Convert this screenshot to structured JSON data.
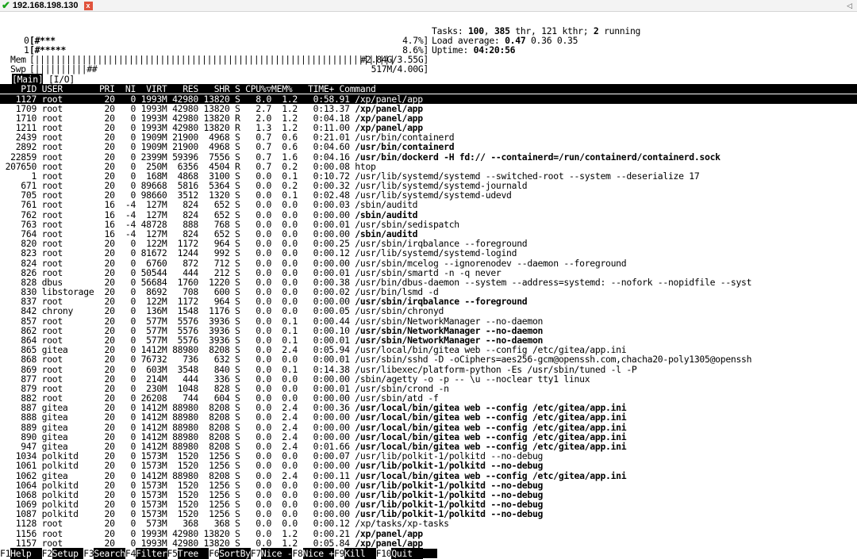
{
  "tab": {
    "title": "192.168.198.130",
    "status_icon": "check-icon",
    "close_icon": "close-icon",
    "scroll_icon": "scroll-left-icon"
  },
  "meters": {
    "cpu0": {
      "label": "0",
      "bar": "[#***",
      "value": "4.7%]"
    },
    "cpu1": {
      "label": "1",
      "bar": "[#*****",
      "value": "8.6%]"
    },
    "mem": {
      "label": "Mem",
      "bar": "[|||||||||||||||||||||||||||||||||||||||||||||||||||||||||||||||||||||",
      "value": "#2.84G/3.55G]"
    },
    "swp": {
      "label": "Swp",
      "bar": "[||||||||||##",
      "value": "517M/4.00G]"
    }
  },
  "summary": {
    "tasks": {
      "label": "Tasks:",
      "count": "100",
      "thr": "385",
      "thr_label": "thr,",
      "kthr": "121 kthr;",
      "running": "2",
      "running_label": "running"
    },
    "load": {
      "label": "Load average:",
      "v1": "0.47",
      "v2": "0.36 0.35"
    },
    "uptime": {
      "label": "Uptime:",
      "value": "04:20:56"
    }
  },
  "tabs_line": {
    "main": "Main",
    "io": "[I/O]"
  },
  "columns": [
    "PID",
    "USER",
    "PRI",
    "NI",
    "VIRT",
    "RES",
    "SHR",
    "S",
    "CPU%",
    "MEM%",
    "TIME+",
    "Command"
  ],
  "sort_indicator": "▽",
  "processes": [
    {
      "pid": "1127",
      "user": "root",
      "pri": "20",
      "ni": "0",
      "virt": "1993M",
      "res": "42980",
      "shr": "13820",
      "s": "S",
      "cpu": "8.0",
      "mem": "1.2",
      "time": "0:58.91",
      "cmd": "/xp/panel/app",
      "bold": false,
      "selected": true
    },
    {
      "pid": "1709",
      "user": "root",
      "pri": "20",
      "ni": "0",
      "virt": "1993M",
      "res": "42980",
      "shr": "13820",
      "s": "S",
      "cpu": "2.7",
      "mem": "1.2",
      "time": "0:13.37",
      "cmd": "/xp/panel/app",
      "bold": true
    },
    {
      "pid": "1710",
      "user": "root",
      "pri": "20",
      "ni": "0",
      "virt": "1993M",
      "res": "42980",
      "shr": "13820",
      "s": "R",
      "cpu": "2.0",
      "mem": "1.2",
      "time": "0:04.18",
      "cmd": "/xp/panel/app",
      "bold": true
    },
    {
      "pid": "1211",
      "user": "root",
      "pri": "20",
      "ni": "0",
      "virt": "1993M",
      "res": "42980",
      "shr": "13820",
      "s": "R",
      "cpu": "1.3",
      "mem": "1.2",
      "time": "0:11.00",
      "cmd": "/xp/panel/app",
      "bold": true
    },
    {
      "pid": "2439",
      "user": "root",
      "pri": "20",
      "ni": "0",
      "virt": "1909M",
      "res": "21900",
      "shr": "4968",
      "s": "S",
      "cpu": "0.7",
      "mem": "0.6",
      "time": "0:21.01",
      "cmd": "/usr/bin/containerd",
      "bold": false
    },
    {
      "pid": "2892",
      "user": "root",
      "pri": "20",
      "ni": "0",
      "virt": "1909M",
      "res": "21900",
      "shr": "4968",
      "s": "S",
      "cpu": "0.7",
      "mem": "0.6",
      "time": "0:04.60",
      "cmd": "/usr/bin/containerd",
      "bold": true
    },
    {
      "pid": "22859",
      "user": "root",
      "pri": "20",
      "ni": "0",
      "virt": "2399M",
      "res": "59396",
      "shr": "7556",
      "s": "S",
      "cpu": "0.7",
      "mem": "1.6",
      "time": "0:04.16",
      "cmd": "/usr/bin/dockerd -H fd:// --containerd=/run/containerd/containerd.sock",
      "bold": true
    },
    {
      "pid": "207650",
      "user": "root",
      "pri": "20",
      "ni": "0",
      "virt": "250M",
      "res": "6356",
      "shr": "4504",
      "s": "R",
      "cpu": "0.7",
      "mem": "0.2",
      "time": "0:00.08",
      "cmd": "htop",
      "bold": false
    },
    {
      "pid": "1",
      "user": "root",
      "pri": "20",
      "ni": "0",
      "virt": "168M",
      "res": "4868",
      "shr": "3100",
      "s": "S",
      "cpu": "0.0",
      "mem": "0.1",
      "time": "0:10.72",
      "cmd": "/usr/lib/systemd/systemd --switched-root --system --deserialize 17",
      "bold": false
    },
    {
      "pid": "671",
      "user": "root",
      "pri": "20",
      "ni": "0",
      "virt": "89668",
      "res": "5816",
      "shr": "5364",
      "s": "S",
      "cpu": "0.0",
      "mem": "0.2",
      "time": "0:00.32",
      "cmd": "/usr/lib/systemd/systemd-journald",
      "bold": false
    },
    {
      "pid": "705",
      "user": "root",
      "pri": "20",
      "ni": "0",
      "virt": "98660",
      "res": "3512",
      "shr": "1320",
      "s": "S",
      "cpu": "0.0",
      "mem": "0.1",
      "time": "0:02.48",
      "cmd": "/usr/lib/systemd/systemd-udevd",
      "bold": false
    },
    {
      "pid": "761",
      "user": "root",
      "pri": "16",
      "ni": "-4",
      "virt": "127M",
      "res": "824",
      "shr": "652",
      "s": "S",
      "cpu": "0.0",
      "mem": "0.0",
      "time": "0:00.03",
      "cmd": "/sbin/auditd",
      "bold": false
    },
    {
      "pid": "762",
      "user": "root",
      "pri": "16",
      "ni": "-4",
      "virt": "127M",
      "res": "824",
      "shr": "652",
      "s": "S",
      "cpu": "0.0",
      "mem": "0.0",
      "time": "0:00.00",
      "cmd": "/sbin/auditd",
      "bold": true
    },
    {
      "pid": "763",
      "user": "root",
      "pri": "16",
      "ni": "-4",
      "virt": "48728",
      "res": "888",
      "shr": "768",
      "s": "S",
      "cpu": "0.0",
      "mem": "0.0",
      "time": "0:00.01",
      "cmd": "/usr/sbin/sedispatch",
      "bold": false
    },
    {
      "pid": "764",
      "user": "root",
      "pri": "16",
      "ni": "-4",
      "virt": "127M",
      "res": "824",
      "shr": "652",
      "s": "S",
      "cpu": "0.0",
      "mem": "0.0",
      "time": "0:00.00",
      "cmd": "/sbin/auditd",
      "bold": true
    },
    {
      "pid": "820",
      "user": "root",
      "pri": "20",
      "ni": "0",
      "virt": "122M",
      "res": "1172",
      "shr": "964",
      "s": "S",
      "cpu": "0.0",
      "mem": "0.0",
      "time": "0:00.25",
      "cmd": "/usr/sbin/irqbalance --foreground",
      "bold": false
    },
    {
      "pid": "823",
      "user": "root",
      "pri": "20",
      "ni": "0",
      "virt": "81672",
      "res": "1244",
      "shr": "992",
      "s": "S",
      "cpu": "0.0",
      "mem": "0.0",
      "time": "0:00.12",
      "cmd": "/usr/lib/systemd/systemd-logind",
      "bold": false
    },
    {
      "pid": "824",
      "user": "root",
      "pri": "20",
      "ni": "0",
      "virt": "6760",
      "res": "872",
      "shr": "712",
      "s": "S",
      "cpu": "0.0",
      "mem": "0.0",
      "time": "0:00.00",
      "cmd": "/usr/sbin/mcelog --ignorenodev --daemon --foreground",
      "bold": false
    },
    {
      "pid": "826",
      "user": "root",
      "pri": "20",
      "ni": "0",
      "virt": "50544",
      "res": "444",
      "shr": "212",
      "s": "S",
      "cpu": "0.0",
      "mem": "0.0",
      "time": "0:00.01",
      "cmd": "/usr/sbin/smartd -n -q never",
      "bold": false
    },
    {
      "pid": "828",
      "user": "dbus",
      "pri": "20",
      "ni": "0",
      "virt": "56684",
      "res": "1760",
      "shr": "1220",
      "s": "S",
      "cpu": "0.0",
      "mem": "0.0",
      "time": "0:00.38",
      "cmd": "/usr/bin/dbus-daemon --system --address=systemd: --nofork --nopidfile --syst",
      "bold": false
    },
    {
      "pid": "830",
      "user": "libstorage",
      "pri": "20",
      "ni": "0",
      "virt": "8692",
      "res": "708",
      "shr": "600",
      "s": "S",
      "cpu": "0.0",
      "mem": "0.0",
      "time": "0:00.02",
      "cmd": "/usr/bin/lsmd -d",
      "bold": false
    },
    {
      "pid": "837",
      "user": "root",
      "pri": "20",
      "ni": "0",
      "virt": "122M",
      "res": "1172",
      "shr": "964",
      "s": "S",
      "cpu": "0.0",
      "mem": "0.0",
      "time": "0:00.00",
      "cmd": "/usr/sbin/irqbalance --foreground",
      "bold": true
    },
    {
      "pid": "842",
      "user": "chrony",
      "pri": "20",
      "ni": "0",
      "virt": "136M",
      "res": "1548",
      "shr": "1176",
      "s": "S",
      "cpu": "0.0",
      "mem": "0.0",
      "time": "0:00.05",
      "cmd": "/usr/sbin/chronyd",
      "bold": false
    },
    {
      "pid": "857",
      "user": "root",
      "pri": "20",
      "ni": "0",
      "virt": "577M",
      "res": "5576",
      "shr": "3936",
      "s": "S",
      "cpu": "0.0",
      "mem": "0.1",
      "time": "0:00.44",
      "cmd": "/usr/sbin/NetworkManager --no-daemon",
      "bold": false
    },
    {
      "pid": "862",
      "user": "root",
      "pri": "20",
      "ni": "0",
      "virt": "577M",
      "res": "5576",
      "shr": "3936",
      "s": "S",
      "cpu": "0.0",
      "mem": "0.1",
      "time": "0:00.10",
      "cmd": "/usr/sbin/NetworkManager --no-daemon",
      "bold": true
    },
    {
      "pid": "864",
      "user": "root",
      "pri": "20",
      "ni": "0",
      "virt": "577M",
      "res": "5576",
      "shr": "3936",
      "s": "S",
      "cpu": "0.0",
      "mem": "0.1",
      "time": "0:00.01",
      "cmd": "/usr/sbin/NetworkManager --no-daemon",
      "bold": true
    },
    {
      "pid": "865",
      "user": "gitea",
      "pri": "20",
      "ni": "0",
      "virt": "1412M",
      "res": "88980",
      "shr": "8208",
      "s": "S",
      "cpu": "0.0",
      "mem": "2.4",
      "time": "0:05.94",
      "cmd": "/usr/local/bin/gitea web --config /etc/gitea/app.ini",
      "bold": false
    },
    {
      "pid": "868",
      "user": "root",
      "pri": "20",
      "ni": "0",
      "virt": "76732",
      "res": "736",
      "shr": "632",
      "s": "S",
      "cpu": "0.0",
      "mem": "0.0",
      "time": "0:00.01",
      "cmd": "/usr/sbin/sshd -D -oCiphers=aes256-gcm@openssh.com,chacha20-poly1305@openssh",
      "bold": false
    },
    {
      "pid": "869",
      "user": "root",
      "pri": "20",
      "ni": "0",
      "virt": "603M",
      "res": "3548",
      "shr": "840",
      "s": "S",
      "cpu": "0.0",
      "mem": "0.1",
      "time": "0:14.38",
      "cmd": "/usr/libexec/platform-python -Es /usr/sbin/tuned -l -P",
      "bold": false
    },
    {
      "pid": "877",
      "user": "root",
      "pri": "20",
      "ni": "0",
      "virt": "214M",
      "res": "444",
      "shr": "336",
      "s": "S",
      "cpu": "0.0",
      "mem": "0.0",
      "time": "0:00.00",
      "cmd": "/sbin/agetty -o -p -- \\u --noclear tty1 linux",
      "bold": false
    },
    {
      "pid": "879",
      "user": "root",
      "pri": "20",
      "ni": "0",
      "virt": "230M",
      "res": "1048",
      "shr": "828",
      "s": "S",
      "cpu": "0.0",
      "mem": "0.0",
      "time": "0:00.01",
      "cmd": "/usr/sbin/crond -n",
      "bold": false
    },
    {
      "pid": "882",
      "user": "root",
      "pri": "20",
      "ni": "0",
      "virt": "26208",
      "res": "744",
      "shr": "604",
      "s": "S",
      "cpu": "0.0",
      "mem": "0.0",
      "time": "0:00.00",
      "cmd": "/usr/sbin/atd -f",
      "bold": false
    },
    {
      "pid": "887",
      "user": "gitea",
      "pri": "20",
      "ni": "0",
      "virt": "1412M",
      "res": "88980",
      "shr": "8208",
      "s": "S",
      "cpu": "0.0",
      "mem": "2.4",
      "time": "0:00.36",
      "cmd": "/usr/local/bin/gitea web --config /etc/gitea/app.ini",
      "bold": true
    },
    {
      "pid": "888",
      "user": "gitea",
      "pri": "20",
      "ni": "0",
      "virt": "1412M",
      "res": "88980",
      "shr": "8208",
      "s": "S",
      "cpu": "0.0",
      "mem": "2.4",
      "time": "0:00.00",
      "cmd": "/usr/local/bin/gitea web --config /etc/gitea/app.ini",
      "bold": true
    },
    {
      "pid": "889",
      "user": "gitea",
      "pri": "20",
      "ni": "0",
      "virt": "1412M",
      "res": "88980",
      "shr": "8208",
      "s": "S",
      "cpu": "0.0",
      "mem": "2.4",
      "time": "0:00.00",
      "cmd": "/usr/local/bin/gitea web --config /etc/gitea/app.ini",
      "bold": true
    },
    {
      "pid": "890",
      "user": "gitea",
      "pri": "20",
      "ni": "0",
      "virt": "1412M",
      "res": "88980",
      "shr": "8208",
      "s": "S",
      "cpu": "0.0",
      "mem": "2.4",
      "time": "0:00.00",
      "cmd": "/usr/local/bin/gitea web --config /etc/gitea/app.ini",
      "bold": true
    },
    {
      "pid": "947",
      "user": "gitea",
      "pri": "20",
      "ni": "0",
      "virt": "1412M",
      "res": "88980",
      "shr": "8208",
      "s": "S",
      "cpu": "0.0",
      "mem": "2.4",
      "time": "0:01.66",
      "cmd": "/usr/local/bin/gitea web --config /etc/gitea/app.ini",
      "bold": true
    },
    {
      "pid": "1034",
      "user": "polkitd",
      "pri": "20",
      "ni": "0",
      "virt": "1573M",
      "res": "1520",
      "shr": "1256",
      "s": "S",
      "cpu": "0.0",
      "mem": "0.0",
      "time": "0:00.07",
      "cmd": "/usr/lib/polkit-1/polkitd --no-debug",
      "bold": false
    },
    {
      "pid": "1061",
      "user": "polkitd",
      "pri": "20",
      "ni": "0",
      "virt": "1573M",
      "res": "1520",
      "shr": "1256",
      "s": "S",
      "cpu": "0.0",
      "mem": "0.0",
      "time": "0:00.00",
      "cmd": "/usr/lib/polkit-1/polkitd --no-debug",
      "bold": true
    },
    {
      "pid": "1062",
      "user": "gitea",
      "pri": "20",
      "ni": "0",
      "virt": "1412M",
      "res": "88980",
      "shr": "8208",
      "s": "S",
      "cpu": "0.0",
      "mem": "2.4",
      "time": "0:00.11",
      "cmd": "/usr/local/bin/gitea web --config /etc/gitea/app.ini",
      "bold": true
    },
    {
      "pid": "1064",
      "user": "polkitd",
      "pri": "20",
      "ni": "0",
      "virt": "1573M",
      "res": "1520",
      "shr": "1256",
      "s": "S",
      "cpu": "0.0",
      "mem": "0.0",
      "time": "0:00.00",
      "cmd": "/usr/lib/polkit-1/polkitd --no-debug",
      "bold": true
    },
    {
      "pid": "1068",
      "user": "polkitd",
      "pri": "20",
      "ni": "0",
      "virt": "1573M",
      "res": "1520",
      "shr": "1256",
      "s": "S",
      "cpu": "0.0",
      "mem": "0.0",
      "time": "0:00.00",
      "cmd": "/usr/lib/polkit-1/polkitd --no-debug",
      "bold": true
    },
    {
      "pid": "1069",
      "user": "polkitd",
      "pri": "20",
      "ni": "0",
      "virt": "1573M",
      "res": "1520",
      "shr": "1256",
      "s": "S",
      "cpu": "0.0",
      "mem": "0.0",
      "time": "0:00.00",
      "cmd": "/usr/lib/polkit-1/polkitd --no-debug",
      "bold": true
    },
    {
      "pid": "1087",
      "user": "polkitd",
      "pri": "20",
      "ni": "0",
      "virt": "1573M",
      "res": "1520",
      "shr": "1256",
      "s": "S",
      "cpu": "0.0",
      "mem": "0.0",
      "time": "0:00.00",
      "cmd": "/usr/lib/polkit-1/polkitd --no-debug",
      "bold": true
    },
    {
      "pid": "1128",
      "user": "root",
      "pri": "20",
      "ni": "0",
      "virt": "573M",
      "res": "368",
      "shr": "368",
      "s": "S",
      "cpu": "0.0",
      "mem": "0.0",
      "time": "0:00.12",
      "cmd": "/xp/tasks/xp-tasks",
      "bold": false
    },
    {
      "pid": "1156",
      "user": "root",
      "pri": "20",
      "ni": "0",
      "virt": "1993M",
      "res": "42980",
      "shr": "13820",
      "s": "S",
      "cpu": "0.0",
      "mem": "1.2",
      "time": "0:00.21",
      "cmd": "/xp/panel/app",
      "bold": true
    },
    {
      "pid": "1157",
      "user": "root",
      "pri": "20",
      "ni": "0",
      "virt": "1993M",
      "res": "42980",
      "shr": "13820",
      "s": "S",
      "cpu": "0.0",
      "mem": "1.2",
      "time": "0:05.84",
      "cmd": "/xp/panel/app",
      "bold": true
    }
  ],
  "function_keys": [
    {
      "key": "F1",
      "label": "Help"
    },
    {
      "key": "F2",
      "label": "Setup"
    },
    {
      "key": "F3",
      "label": "Search"
    },
    {
      "key": "F4",
      "label": "Filter"
    },
    {
      "key": "F5",
      "label": "Tree"
    },
    {
      "key": "F6",
      "label": "SortBy"
    },
    {
      "key": "F7",
      "label": "Nice -"
    },
    {
      "key": "F8",
      "label": "Nice +"
    },
    {
      "key": "F9",
      "label": "Kill"
    },
    {
      "key": "F10",
      "label": "Quit"
    }
  ],
  "colors": {
    "selected_bg": "#000000",
    "selected_fg": "#ffffff",
    "tab_close": "#e0533c",
    "status_ok": "#1aa31a"
  }
}
